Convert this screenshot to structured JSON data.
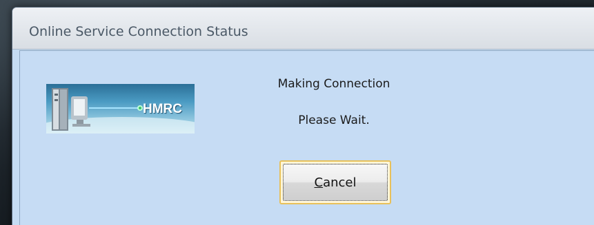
{
  "window": {
    "title": "Online Service Connection Status"
  },
  "logo": {
    "text": "HMRC",
    "icon": "computer-network-icon"
  },
  "status": {
    "line1": "Making Connection",
    "line2": "Please Wait."
  },
  "buttons": {
    "cancel": {
      "accel": "C",
      "rest": "ancel"
    }
  },
  "colors": {
    "client_background": "#c6dcf4",
    "focus_border": "#e8c15a",
    "title_text": "#4a5866"
  }
}
